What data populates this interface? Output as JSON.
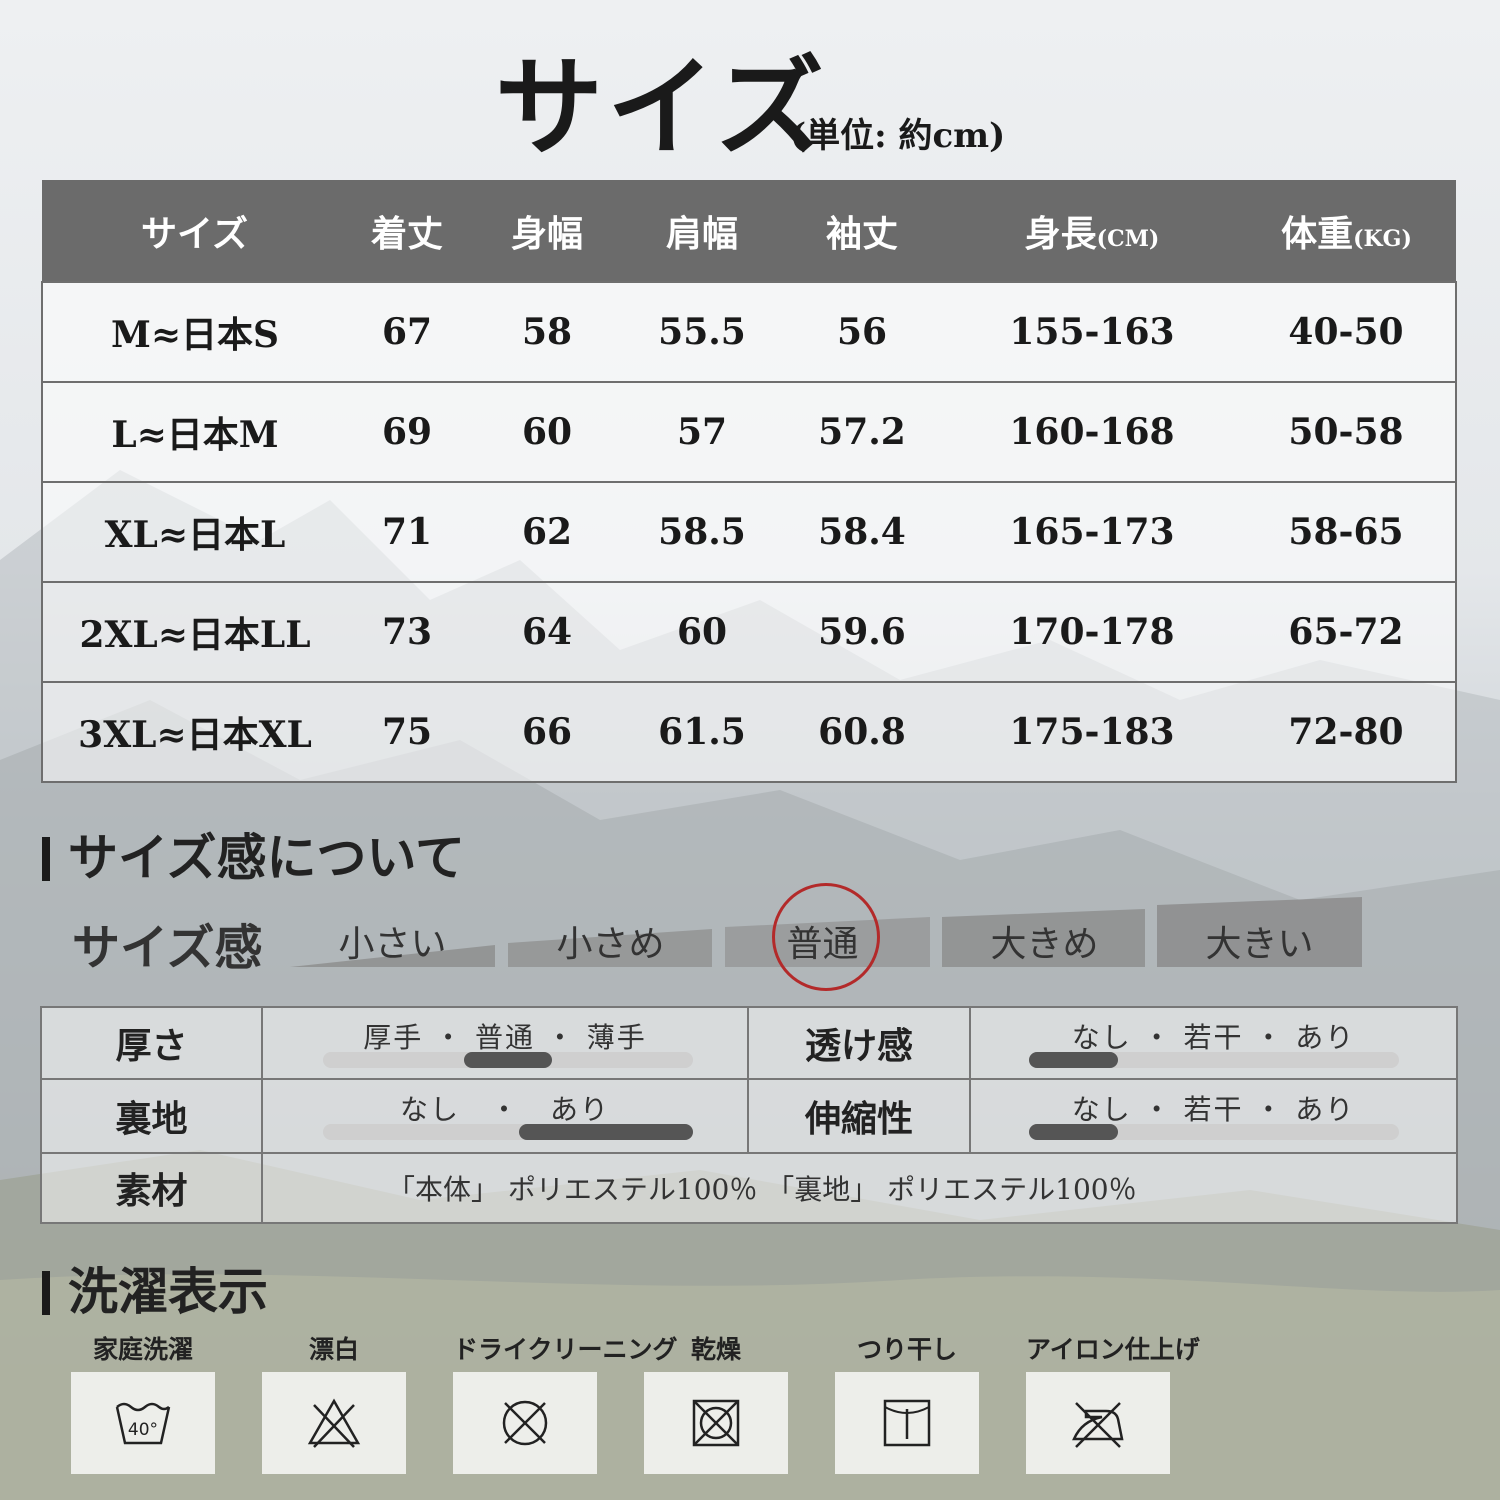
{
  "title": "サイズ",
  "title_unit": "(単位: 約cm)",
  "size_table": {
    "headers": [
      {
        "main": "サイズ",
        "unit": ""
      },
      {
        "main": "着丈",
        "unit": ""
      },
      {
        "main": "身幅",
        "unit": ""
      },
      {
        "main": "肩幅",
        "unit": ""
      },
      {
        "main": "袖丈",
        "unit": ""
      },
      {
        "main": "身長",
        "unit": "(CM)"
      },
      {
        "main": "体重",
        "unit": "(KG)"
      }
    ],
    "rows": [
      [
        "M≈日本S",
        "67",
        "58",
        "55.5",
        "56",
        "155-163",
        "40-50"
      ],
      [
        "L≈日本M",
        "69",
        "60",
        "57",
        "57.2",
        "160-168",
        "50-58"
      ],
      [
        "XL≈日本L",
        "71",
        "62",
        "58.5",
        "58.4",
        "165-173",
        "58-65"
      ],
      [
        "2XL≈日本LL",
        "73",
        "64",
        "60",
        "59.6",
        "170-178",
        "65-72"
      ],
      [
        "3XL≈日本XL",
        "75",
        "66",
        "61.5",
        "60.8",
        "175-183",
        "72-80"
      ]
    ]
  },
  "fit_section": {
    "heading": "サイズ感について",
    "label": "サイズ感",
    "options": [
      "小さい",
      "小さめ",
      "普通",
      "大きめ",
      "大きい"
    ],
    "selected": "普通",
    "selected_color": "#b32a2a"
  },
  "attributes": {
    "thickness": {
      "label": "厚さ",
      "options": "厚手 ・ 普通 ・ 薄手",
      "level_start": 0.38,
      "level_end": 0.62
    },
    "transparency": {
      "label": "透け感",
      "options": "なし ・ 若干 ・ あり",
      "level_start": 0.0,
      "level_end": 0.24
    },
    "lining": {
      "label": "裏地",
      "options": "なし　・　あり",
      "level_start": 0.53,
      "level_end": 1.0
    },
    "stretch": {
      "label": "伸縮性",
      "options": "なし ・ 若干 ・ あり",
      "level_start": 0.0,
      "level_end": 0.24
    },
    "material": {
      "label": "素材",
      "value": "「本体」 ポリエステル100％ 「裏地」 ポリエステル100％"
    }
  },
  "care_section": {
    "heading": "洗濯表示",
    "items": [
      {
        "name": "家庭洗濯",
        "icon": "wash-40-icon",
        "temp": "40°"
      },
      {
        "name": "漂白",
        "icon": "no-bleach-icon"
      },
      {
        "name": "ドライクリーニング",
        "icon": "no-dry-clean-icon"
      },
      {
        "name": "乾燥",
        "icon": "no-tumble-dry-icon"
      },
      {
        "name": "つり干し",
        "icon": "line-dry-icon"
      },
      {
        "name": "アイロン仕上げ",
        "icon": "no-iron-icon"
      }
    ]
  }
}
